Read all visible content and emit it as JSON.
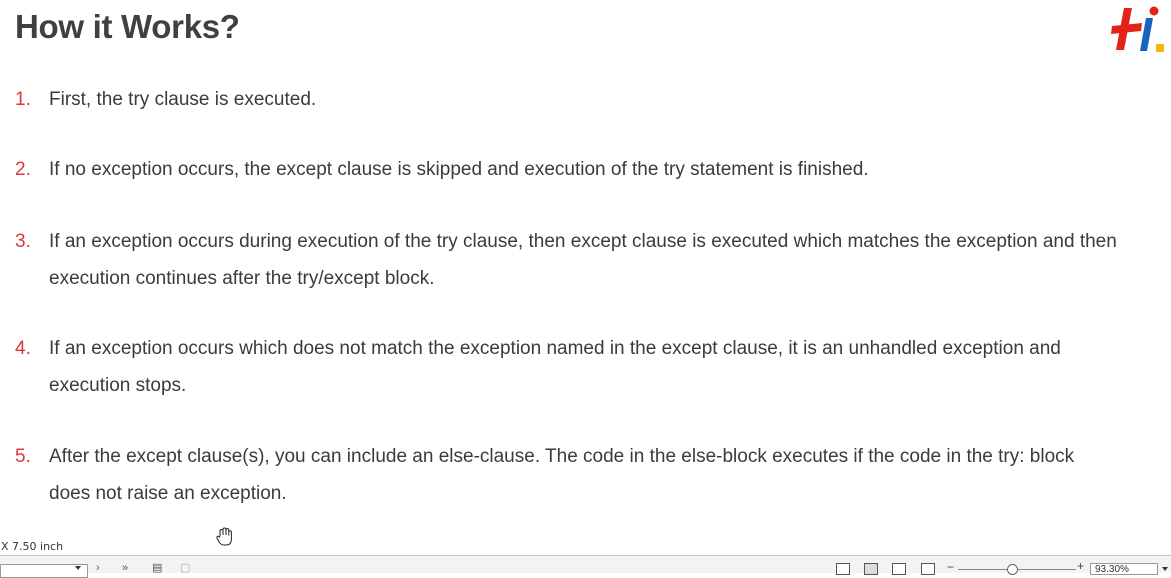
{
  "slide": {
    "title": "How it Works?",
    "items": [
      {
        "num": "1.",
        "text": "First, the try clause is executed."
      },
      {
        "num": "2.",
        "text": "If no exception occurs, the except clause is skipped and execution of the try statement is finished."
      },
      {
        "num": "3.",
        "text": "If an exception occurs during execution of the try clause, then except clause is executed which matches the exception and then execution continues after the try/except block."
      },
      {
        "num": "4.",
        "text": "If an exception occurs which does not match the exception named in the except clause, it is an unhandled exception and execution stops."
      },
      {
        "num": "5.",
        "text": "After the except clause(s), you can include an else-clause. The code in the else-block executes if the code in the try: block does not raise an exception."
      }
    ],
    "colors": {
      "number": "#d8393a",
      "logo_red": "#e2231a",
      "logo_blue": "#1565c0",
      "logo_yellow": "#f5b800"
    }
  },
  "status": {
    "dimension": "X 7.50 inch",
    "zoom": "93.30%"
  }
}
